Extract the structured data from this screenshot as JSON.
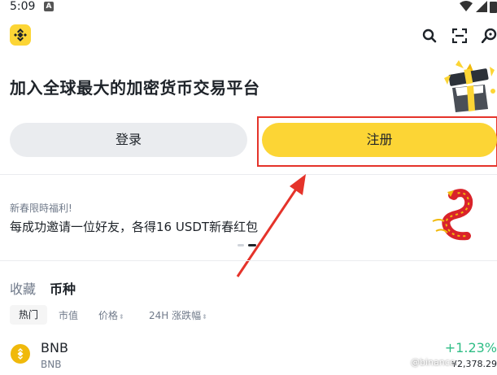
{
  "status_bar": {
    "time": "5:09",
    "app_icon_letter": "A"
  },
  "header": {
    "icons": [
      "binance-logo-icon",
      "search-icon",
      "scan-icon",
      "support-icon"
    ]
  },
  "hero": {
    "title": "加入全球最大的加密货币交易平台"
  },
  "auth": {
    "login_label": "登录",
    "register_label": "注册"
  },
  "promo": {
    "tag": "新春限時福利!",
    "text": "每成功邀请一位好友，各得16 USDT新春红包",
    "page_count": 2,
    "active_page": 2
  },
  "market": {
    "tabs": [
      {
        "label": "收藏",
        "active": false
      },
      {
        "label": "币种",
        "active": true
      }
    ],
    "filters": [
      {
        "label": "热门",
        "active": true,
        "sortable": false
      },
      {
        "label": "市值",
        "active": false,
        "sortable": false
      },
      {
        "label": "价格",
        "active": false,
        "sortable": true
      },
      {
        "label": "24H 涨跌幅",
        "active": false,
        "sortable": true
      }
    ],
    "rows": [
      {
        "symbol": "BNB",
        "subtitle": "BNB",
        "change": "+1.23%",
        "price": "¥2,378.29"
      }
    ]
  },
  "watermark": "@binance",
  "colors": {
    "brand": "#fcd535",
    "positive": "#2ebd85",
    "annotation": "#e5332a"
  }
}
